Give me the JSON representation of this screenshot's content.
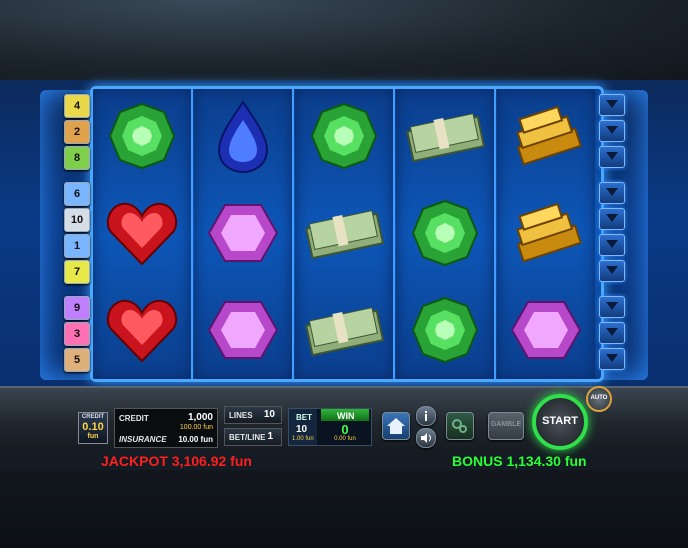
{
  "denomination": {
    "label": "CREDIT",
    "value": "0.10",
    "unit": "fun"
  },
  "credit": {
    "label": "CREDIT",
    "value": "1,000",
    "sub": "100.00 fun"
  },
  "insurance": {
    "label": "INSURANCE",
    "value": "10.00 fun"
  },
  "lines": {
    "label": "LINES",
    "value": "10"
  },
  "bet_line": {
    "label": "BET/LINE",
    "value": "1"
  },
  "bet": {
    "label": "BET",
    "value": "10",
    "sub": "1.00 fun"
  },
  "win": {
    "label": "WIN",
    "value": "0",
    "sub": "0.00 fun"
  },
  "buttons": {
    "gamble": "GAMBLE",
    "start": "START",
    "auto": "AUTO"
  },
  "jackpot": "JACKPOT 3,106.92 fun",
  "bonus": "BONUS 1,134.30 fun",
  "line_numbers_left": [
    {
      "n": "4",
      "color": "#e8d84a"
    },
    {
      "n": "2",
      "color": "#e0a24a"
    },
    {
      "n": "8",
      "color": "#7fcf4a"
    },
    {
      "n": "6",
      "color": "#79b6ff"
    },
    {
      "n": "10",
      "color": "#d7dde6"
    },
    {
      "n": "1",
      "color": "#79b6ff"
    },
    {
      "n": "7",
      "color": "#e8e84a"
    },
    {
      "n": "9",
      "color": "#c07fff"
    },
    {
      "n": "3",
      "color": "#ff6fb4"
    },
    {
      "n": "5",
      "color": "#e0b07a"
    }
  ],
  "reels": [
    [
      "emerald",
      "heart",
      "heart"
    ],
    [
      "sapphire",
      "amethyst",
      "amethyst"
    ],
    [
      "emerald",
      "money",
      "money"
    ],
    [
      "money",
      "emerald",
      "emerald"
    ],
    [
      "gold",
      "gold",
      "amethyst"
    ]
  ]
}
